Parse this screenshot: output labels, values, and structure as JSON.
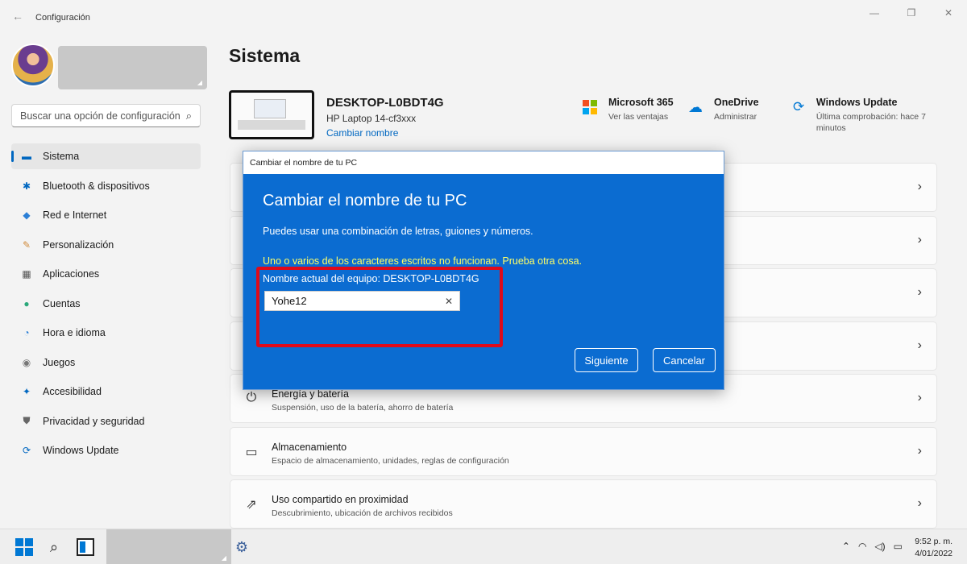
{
  "window": {
    "title": "Configuración",
    "back_icon": "←",
    "minimize_icon": "—",
    "maximize_icon": "❐",
    "close_icon": "✕"
  },
  "sidebar": {
    "search_placeholder": "Buscar una opción de configuración",
    "search_icon": "⌕",
    "items": [
      {
        "label": "Sistema",
        "icon": "▬",
        "icon_color": "#0067c0"
      },
      {
        "label": "Bluetooth & dispositivos",
        "icon": "✱",
        "icon_color": "#0067c0"
      },
      {
        "label": "Red e Internet",
        "icon": "◆",
        "icon_color": "#2b7fd6"
      },
      {
        "label": "Personalización",
        "icon": "✎",
        "icon_color": "#d08a3a"
      },
      {
        "label": "Aplicaciones",
        "icon": "▦",
        "icon_color": "#555555"
      },
      {
        "label": "Cuentas",
        "icon": "●",
        "icon_color": "#2aa87a"
      },
      {
        "label": "Hora e idioma",
        "icon": "◔",
        "icon_color": "#2b7fd6"
      },
      {
        "label": "Juegos",
        "icon": "◉",
        "icon_color": "#777777"
      },
      {
        "label": "Accesibilidad",
        "icon": "✦",
        "icon_color": "#0067c0"
      },
      {
        "label": "Privacidad y seguridad",
        "icon": "⛊",
        "icon_color": "#666666"
      },
      {
        "label": "Windows Update",
        "icon": "⟳",
        "icon_color": "#0067c0"
      }
    ]
  },
  "main": {
    "title": "Sistema",
    "device": {
      "name": "DESKTOP-L0BDT4G",
      "model": "HP Laptop 14-cf3xxx",
      "rename_link": "Cambiar nombre"
    },
    "quick_links": [
      {
        "title": "Microsoft 365",
        "sub": "Ver las ventajas"
      },
      {
        "title": "OneDrive",
        "sub": "Administrar"
      },
      {
        "title": "Windows Update",
        "sub": "Última comprobación: hace 7 minutos"
      }
    ],
    "cards": [
      {
        "title": "",
        "sub": "",
        "icon": ""
      },
      {
        "title": "",
        "sub": "",
        "icon": ""
      },
      {
        "title": "",
        "sub": "",
        "icon": ""
      },
      {
        "title": "",
        "sub": "",
        "icon": ""
      },
      {
        "title": "Energía y batería",
        "sub": "Suspensión, uso de la batería, ahorro de batería",
        "icon": "⏻"
      },
      {
        "title": "Almacenamiento",
        "sub": "Espacio de almacenamiento, unidades, reglas de configuración",
        "icon": "▭"
      },
      {
        "title": "Uso compartido en proximidad",
        "sub": "Descubrimiento, ubicación de archivos recibidos",
        "icon": "⇗"
      }
    ],
    "chevron": "›"
  },
  "dialog": {
    "titlebar": "Cambiar el nombre de tu PC",
    "heading": "Cambiar el nombre de tu PC",
    "description": "Puedes usar una combinación de letras, guiones y números.",
    "error": "Uno o varios de los caracteres escritos no funcionan. Prueba otra cosa.",
    "current_name": "Nombre actual del equipo: DESKTOP-L0BDT4G",
    "input_value": "Yohe12",
    "clear_icon": "✕",
    "next_label": "Siguiente",
    "cancel_label": "Cancelar",
    "bg_color": "#0b6cd1",
    "highlight_color": "#e00a1a"
  },
  "taskbar": {
    "search_icon": "⌕",
    "settings_icon": "⚙",
    "tray": {
      "chevron": "⌃",
      "wifi": "◠",
      "volume": "◁)",
      "battery": "▭"
    },
    "time": "9:52 p. m.",
    "date": "4/01/2022"
  }
}
